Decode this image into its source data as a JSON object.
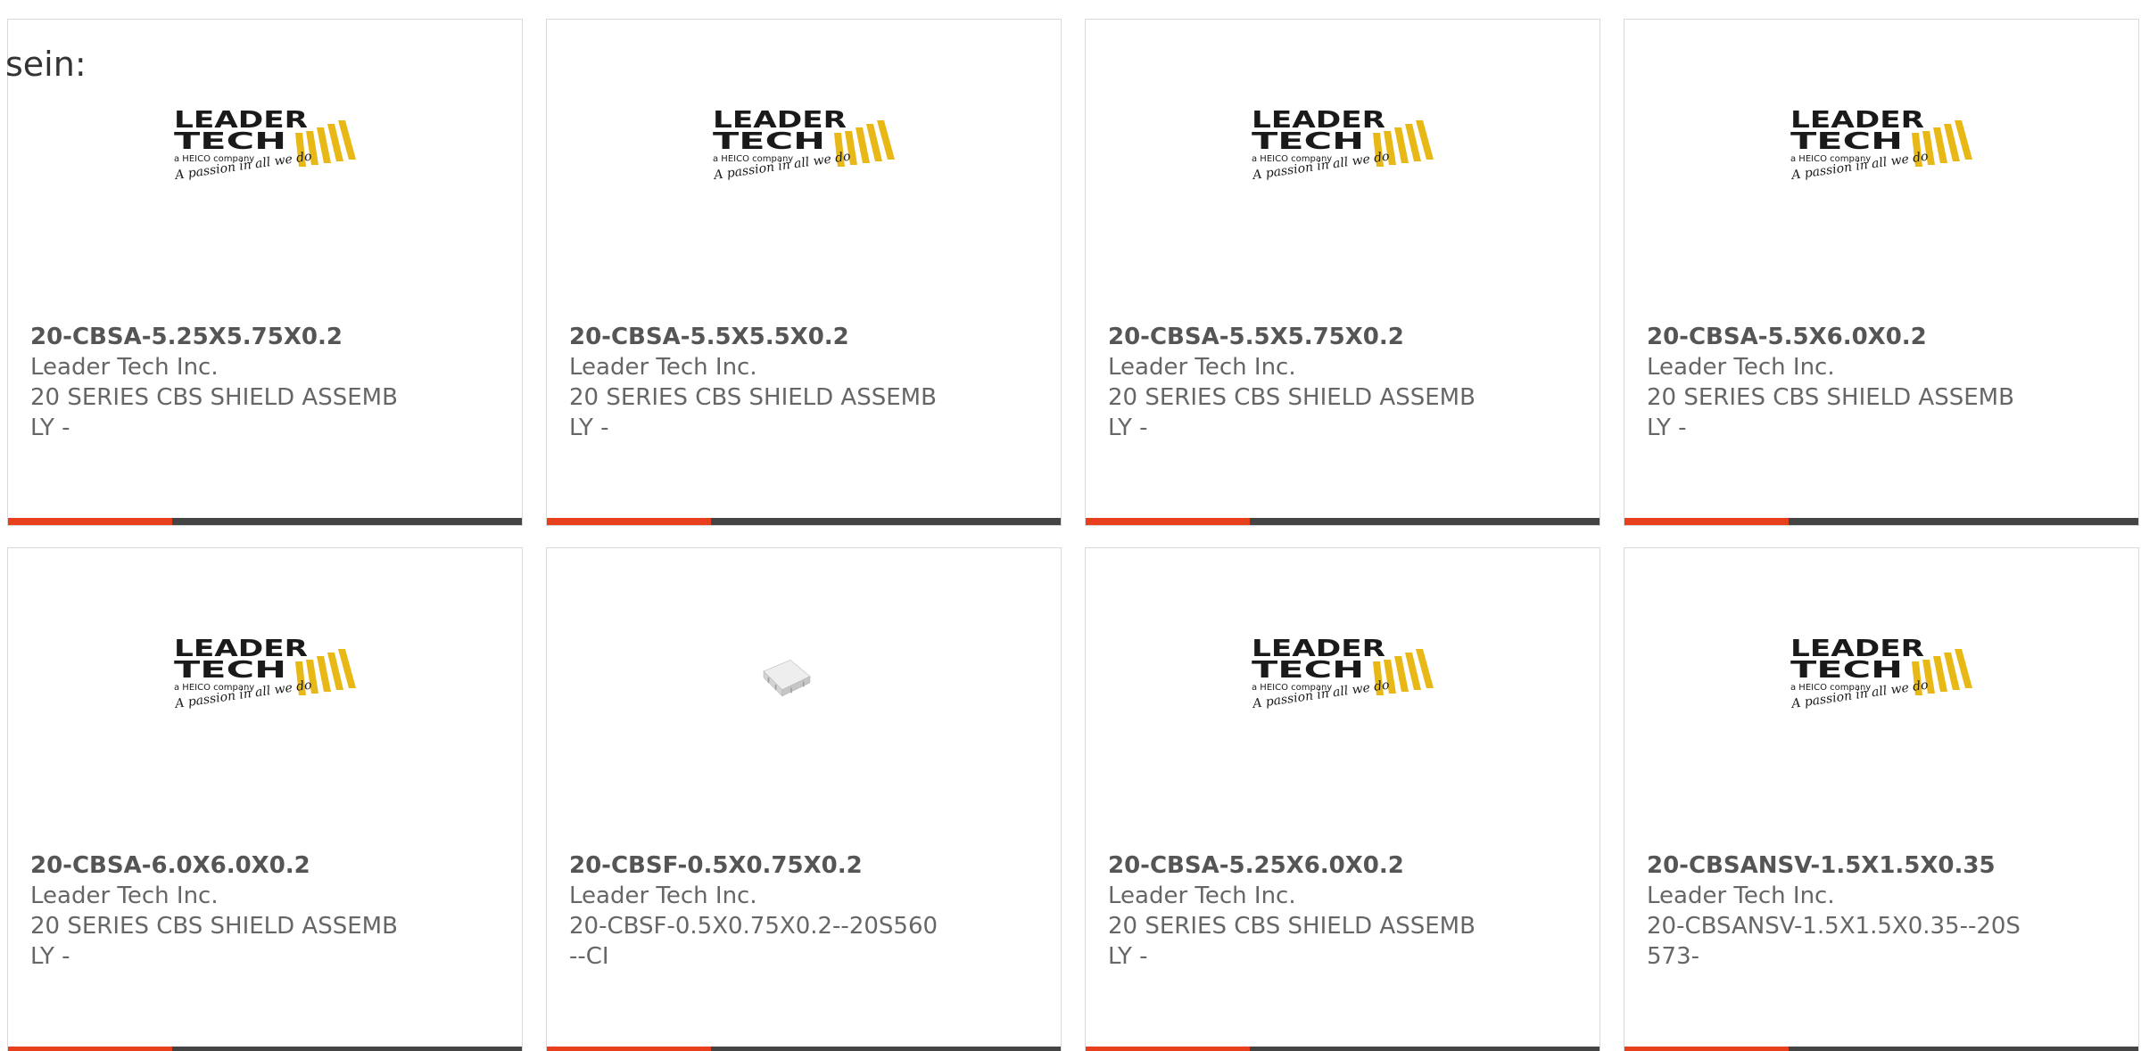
{
  "lead_text": "sein:",
  "colors": {
    "accent": "#e8401c",
    "bar": "#444444",
    "logo_yellow": "#e8b817",
    "logo_text": "#1a1a1a"
  },
  "logo": {
    "line1": "LEADER",
    "line2": "TECH",
    "tagline": "a HEICO company",
    "slogan": "A passion in all we do"
  },
  "products": [
    {
      "image": "leader-tech-logo",
      "part": "20-CBSA-5.25X5.75X0.2",
      "manufacturer": "Leader Tech Inc.",
      "description": "20 SERIES CBS SHIELD ASSEMBLY -"
    },
    {
      "image": "leader-tech-logo",
      "part": "20-CBSA-5.5X5.5X0.2",
      "manufacturer": "Leader Tech Inc.",
      "description": "20 SERIES CBS SHIELD ASSEMBLY -"
    },
    {
      "image": "leader-tech-logo",
      "part": "20-CBSA-5.5X5.75X0.2",
      "manufacturer": "Leader Tech Inc.",
      "description": "20 SERIES CBS SHIELD ASSEMBLY -"
    },
    {
      "image": "leader-tech-logo",
      "part": "20-CBSA-5.5X6.0X0.2",
      "manufacturer": "Leader Tech Inc.",
      "description": "20 SERIES CBS SHIELD ASSEMBLY -"
    },
    {
      "image": "leader-tech-logo",
      "part": "20-CBSA-6.0X6.0X0.2",
      "manufacturer": "Leader Tech Inc.",
      "description": "20 SERIES CBS SHIELD ASSEMBLY -"
    },
    {
      "image": "shield-photo",
      "part": "20-CBSF-0.5X0.75X0.2",
      "manufacturer": "Leader Tech Inc.",
      "description": "20-CBSF-0.5X0.75X0.2--20S560--CI"
    },
    {
      "image": "leader-tech-logo",
      "part": "20-CBSA-5.25X6.0X0.2",
      "manufacturer": "Leader Tech Inc.",
      "description": "20 SERIES CBS SHIELD ASSEMBLY -"
    },
    {
      "image": "leader-tech-logo",
      "part": "20-CBSANSV-1.5X1.5X0.35",
      "manufacturer": "Leader Tech Inc.",
      "description": "20-CBSANSV-1.5X1.5X0.35--20S573-"
    }
  ]
}
